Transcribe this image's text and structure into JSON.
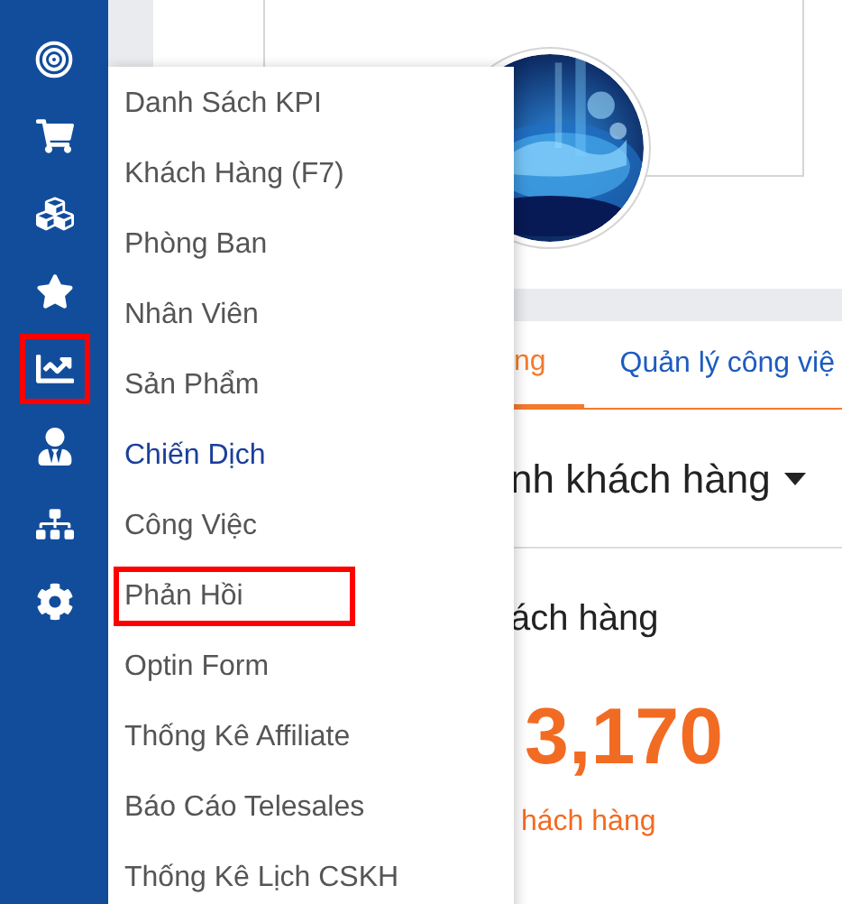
{
  "sidebar": {
    "items": [
      {
        "kind": "target",
        "highlighted": false
      },
      {
        "kind": "cart",
        "highlighted": false
      },
      {
        "kind": "cubes",
        "highlighted": false
      },
      {
        "kind": "star",
        "highlighted": false
      },
      {
        "kind": "chart",
        "highlighted": true
      },
      {
        "kind": "user",
        "highlighted": false
      },
      {
        "kind": "sitemap",
        "highlighted": false
      },
      {
        "kind": "settings",
        "highlighted": false
      }
    ]
  },
  "menu": {
    "items": [
      {
        "label": "Danh Sách KPI",
        "selected": false,
        "highlighted": false
      },
      {
        "label": "Khách Hàng (F7)",
        "selected": false,
        "highlighted": false
      },
      {
        "label": "Phòng Ban",
        "selected": false,
        "highlighted": false
      },
      {
        "label": "Nhân Viên",
        "selected": false,
        "highlighted": false
      },
      {
        "label": "Sản Phẩm",
        "selected": false,
        "highlighted": false
      },
      {
        "label": "Chiến Dịch",
        "selected": true,
        "highlighted": false
      },
      {
        "label": "Công Việc",
        "selected": false,
        "highlighted": false
      },
      {
        "label": "Phản Hồi",
        "selected": false,
        "highlighted": true
      },
      {
        "label": "Optin Form",
        "selected": false,
        "highlighted": false
      },
      {
        "label": "Thống Kê Affiliate",
        "selected": false,
        "highlighted": false
      },
      {
        "label": "Báo Cáo Telesales",
        "selected": false,
        "highlighted": false
      },
      {
        "label": "Thống Kê Lịch CSKH",
        "selected": false,
        "highlighted": false
      }
    ]
  },
  "tabs": [
    {
      "label": "ng",
      "selected": true
    },
    {
      "label": "Quản lý công việ",
      "selected": false
    }
  ],
  "dropdown": {
    "label": "nh khách hàng"
  },
  "section": {
    "title": "ách hàng"
  },
  "stat": {
    "value": "3,170",
    "label": "hách hàng"
  }
}
